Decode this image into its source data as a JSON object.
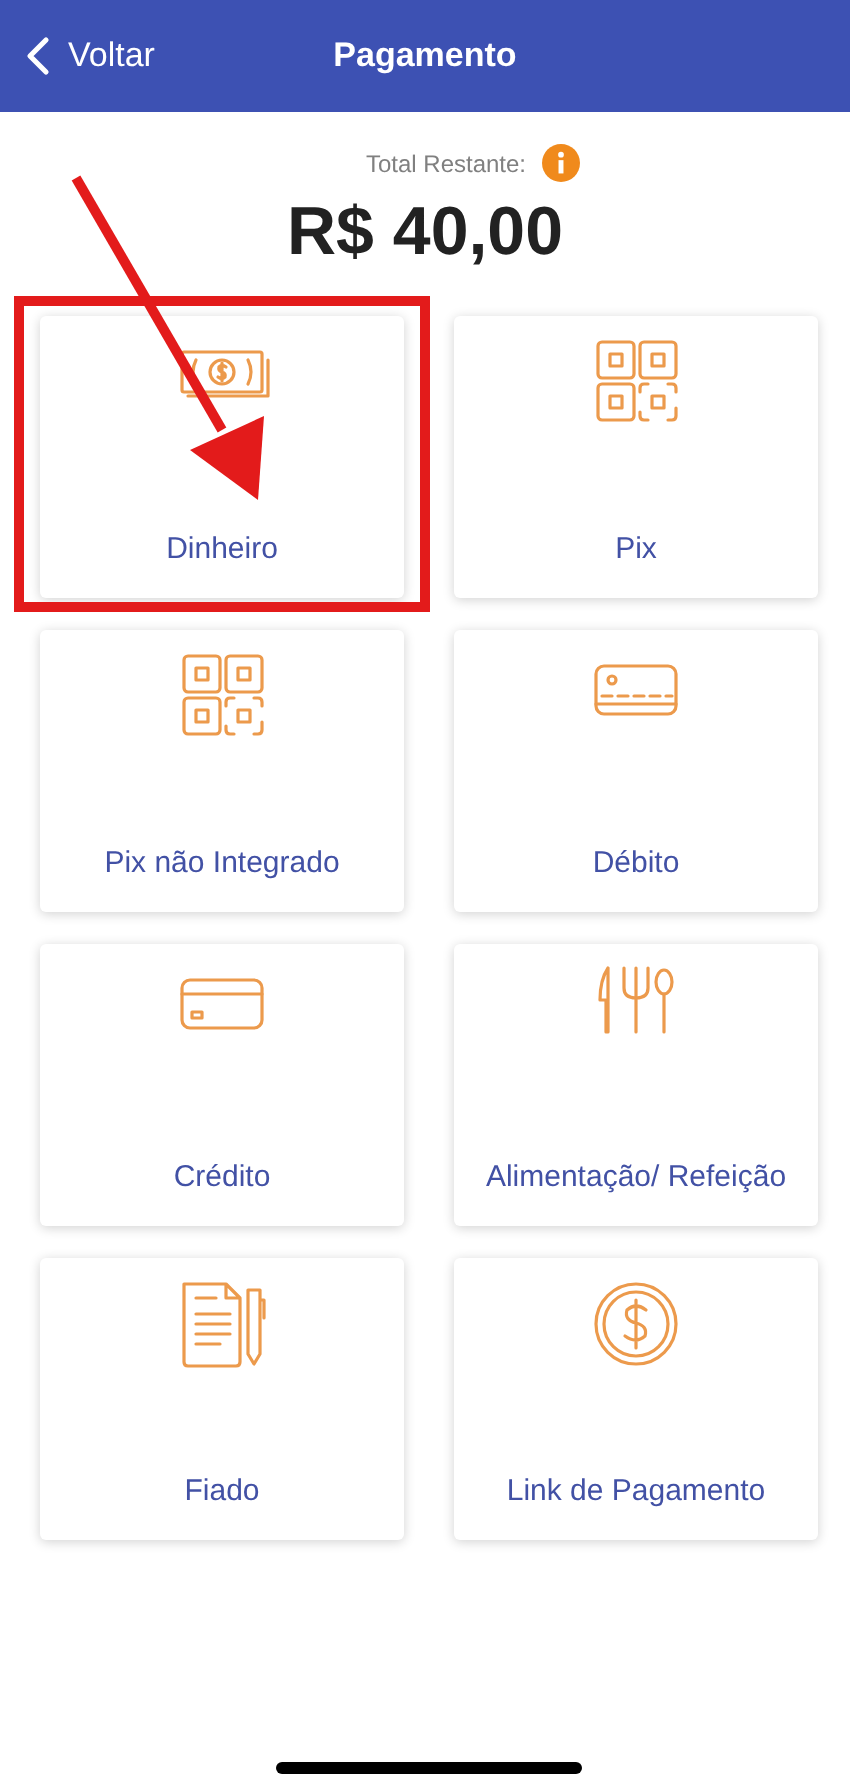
{
  "header": {
    "back_label": "Voltar",
    "title": "Pagamento"
  },
  "total": {
    "label": "Total Restante:",
    "amount": "R$ 40,00"
  },
  "payment_options": [
    {
      "label": "Dinheiro",
      "kind": "cash",
      "highlighted": true
    },
    {
      "label": "Pix",
      "kind": "qr",
      "highlighted": false
    },
    {
      "label": "Pix não Integrado",
      "kind": "qr",
      "highlighted": false
    },
    {
      "label": "Débito",
      "kind": "debit",
      "highlighted": false
    },
    {
      "label": "Crédito",
      "kind": "credit",
      "highlighted": false
    },
    {
      "label": "Alimentação/ Refeição",
      "kind": "meal",
      "highlighted": false
    },
    {
      "label": "Fiado",
      "kind": "document",
      "highlighted": false
    },
    {
      "label": "Link de Pagamento",
      "kind": "coin",
      "highlighted": false
    }
  ]
}
